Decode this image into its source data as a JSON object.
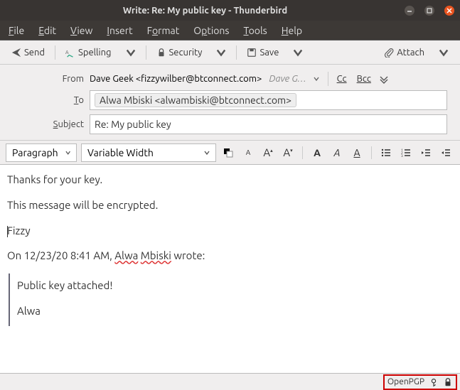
{
  "window": {
    "title": "Write: Re: My public key - Thunderbird"
  },
  "menu": {
    "file": "File",
    "edit": "Edit",
    "view": "View",
    "insert": "Insert",
    "format": "Format",
    "options": "Options",
    "tools": "Tools",
    "help": "Help"
  },
  "toolbar": {
    "send": "Send",
    "spelling": "Spelling",
    "security": "Security",
    "save": "Save",
    "attach": "Attach"
  },
  "headers": {
    "from_label": "From",
    "from_value": "Dave Geek <fizzywilber@btconnect.com>",
    "from_identity": "Dave G…",
    "cc": "Cc",
    "bcc": "Bcc",
    "to_label": "To",
    "to_value": "Alwa Mbiski <alwambiski@btconnect.com>",
    "subject_label": "Subject",
    "subject_value": "Re: My public key"
  },
  "format": {
    "paragraph": "Paragraph",
    "font": "Variable Width"
  },
  "body": {
    "line1": "Thanks for your key.",
    "line2": "This message will be encrypted.",
    "signature": "Fizzy",
    "quote_intro_pre": "On 12/23/20 8:41 AM, ",
    "quote_name1": "Alwa",
    "quote_name2": "Mbiski",
    "quote_intro_post": " wrote:",
    "quoted1": "Public key attached!",
    "quoted2": "Alwa"
  },
  "status": {
    "openpgp": "OpenPGP"
  }
}
